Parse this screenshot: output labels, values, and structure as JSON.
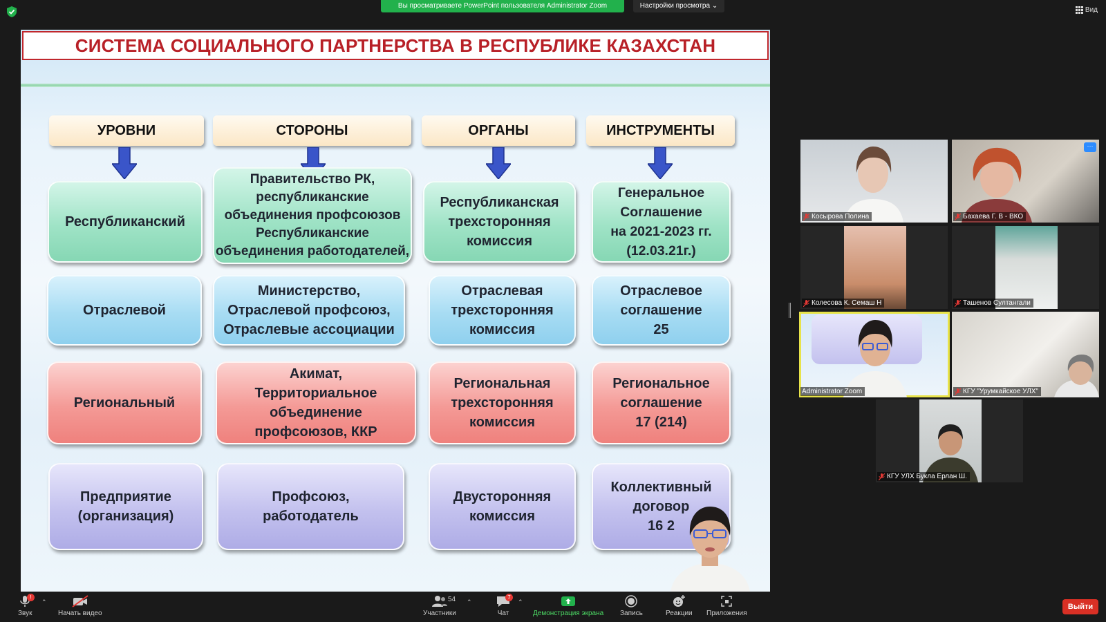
{
  "topbar": {
    "banner": "Вы просматриваете PowerPoint пользователя Administrator Zoom",
    "view_options": "Настройки просмотра ⌄",
    "view_button": "Вид"
  },
  "slide": {
    "title": "СИСТЕМА СОЦИАЛЬНОГО ПАРТНЕРСТВА В РЕСПУБЛИКЕ КАЗАХСТАН",
    "columns": [
      "УРОВНИ",
      "СТОРОНЫ",
      "ОРГАНЫ",
      "ИНСТРУМЕНТЫ"
    ],
    "rows": [
      {
        "level": "Республиканский",
        "parties": "Правительство РК,\nреспубликанские\nобъединения профсоюзов\nРеспубликанские\nобъединения работодателей,",
        "bodies": "Республиканская\nтрехсторонняя\nкомиссия",
        "instruments": "Генеральное\nСоглашение\nна 2021-2023 гг.\n(12.03.21г.)"
      },
      {
        "level": "Отраслевой",
        "parties": "Министерство,\nОтраслевой профсоюз,\nОтраслевые ассоциации",
        "bodies": "Отраслевая\nтрехсторонняя\nкомиссия",
        "instruments": "Отраслевое\nсоглашение\n25"
      },
      {
        "level": "Региональный",
        "parties": "Акимат,\nТерриториальное\nобъединение\nпрофсоюзов,  ККР",
        "bodies": "Региональная\nтрехсторонняя\nкомиссия",
        "instruments": "Региональное\nсоглашение\n17 (214)"
      },
      {
        "level": "Предприятие\n(организация)",
        "parties": "Профсоюз,\nработодатель",
        "bodies": "Двусторонняя\nкомиссия",
        "instruments": "Коллективный\nдоговор\n16 2"
      }
    ]
  },
  "participants": [
    {
      "name": "Косырова Полина",
      "muted": true
    },
    {
      "name": "Бахаева Г. В - ВКО",
      "muted": true
    },
    {
      "name": "Колесова К. Семаш Н",
      "muted": true
    },
    {
      "name": "Ташенов Султангали",
      "muted": true
    },
    {
      "name": "Administrator Zoom",
      "muted": false,
      "active": true
    },
    {
      "name": "КГУ \"Урумкайское УЛХ\"",
      "muted": true
    },
    {
      "name": "КГУ УЛХ Букла Ерлан Ш.",
      "muted": true
    }
  ],
  "toolbar": {
    "audio": "Звук",
    "audio_badge": "!",
    "video": "Начать видео",
    "participants": "Участники",
    "participants_count": "54",
    "chat": "Чат",
    "chat_badge": "7",
    "share": "Демонстрация экрана",
    "record": "Запись",
    "reactions": "Реакции",
    "apps": "Приложения",
    "leave": "Выйти"
  },
  "colors": {
    "banner": "#22b14c",
    "title_red": "#b82027",
    "leave": "#d93025",
    "active_tile": "#e8e34a",
    "row_green": "#9fe3c6",
    "row_blue": "#a7dcf3",
    "row_red": "#f49a96",
    "row_purple": "#c3c1ee"
  }
}
